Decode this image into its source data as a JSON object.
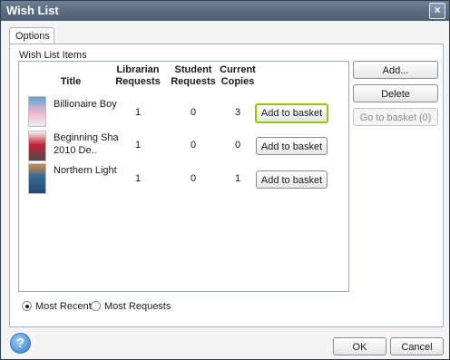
{
  "window": {
    "title": "Wish List",
    "close_glyph": "×"
  },
  "tabs": [
    {
      "label": "Options"
    }
  ],
  "section": {
    "label": "Wish List Items"
  },
  "columns": {
    "title": "Title",
    "librarian": [
      "Librarian",
      "Requests"
    ],
    "student": [
      "Student",
      "Requests"
    ],
    "copies": [
      "Current",
      "Copies"
    ]
  },
  "items": [
    {
      "title_lines": [
        "Billionaire Boy",
        ""
      ],
      "librarian": "1",
      "student": "0",
      "copies": "3",
      "action": "Add to basket",
      "cover_colors": [
        "#5aa6d6",
        "#f0b7c9",
        "#e8eef3"
      ]
    },
    {
      "title_lines": [
        "Beginning Sha",
        "2010 De.."
      ],
      "librarian": "1",
      "student": "0",
      "copies": "0",
      "action": "Add to basket",
      "cover_colors": [
        "#f4f4f4",
        "#c72231",
        "#4b4b4b"
      ]
    },
    {
      "title_lines": [
        "Northern Light",
        ""
      ],
      "librarian": "1",
      "student": "0",
      "copies": "1",
      "action": "Add to basket",
      "cover_colors": [
        "#3b6b9a",
        "#d88c3a",
        "#21496f"
      ]
    }
  ],
  "side_buttons": {
    "add": "Add...",
    "delete": "Delete",
    "go_to_basket": "Go to basket (0)"
  },
  "sort": {
    "most_recent": "Most Recent",
    "most_requests": "Most Requests",
    "selected": "most_recent"
  },
  "footer": {
    "ok": "OK",
    "cancel": "Cancel",
    "help_glyph": "?"
  },
  "colors": {
    "focus_outline": "#9bc400",
    "titlebar": "#5a6a80"
  }
}
